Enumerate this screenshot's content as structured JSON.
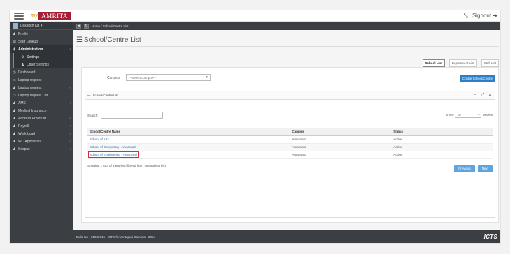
{
  "header": {
    "logo_prefix": "my",
    "logo_brand": "AMRITA",
    "expand_icon": "⤡",
    "signout_label": "Signout ➜"
  },
  "sidebar": {
    "user": "Dakshith KB ▾",
    "items": [
      {
        "icon": "♟",
        "label": "Profile"
      },
      {
        "icon": "▤",
        "label": "Staff Lookup"
      },
      {
        "icon": "♟",
        "label": "Administration",
        "chev": "‹"
      },
      {
        "icon": "⚙",
        "label": "Settings",
        "sub": true
      },
      {
        "icon": "♟",
        "label": "Other Settings",
        "sub": true
      },
      {
        "icon": "◷",
        "label": "Dashboard"
      },
      {
        "icon": "▭",
        "label": "Laptop request"
      },
      {
        "icon": "♟",
        "label": "Laptop request",
        "chev": "‹"
      },
      {
        "icon": "▭",
        "label": "Laptop request List"
      },
      {
        "icon": "♟",
        "label": "AMS",
        "chev": "‹"
      },
      {
        "icon": "♟",
        "label": "Medical Insurance"
      },
      {
        "icon": "♟",
        "label": "Address Proof Ltd.",
        "chev": "‹"
      },
      {
        "icon": "♟",
        "label": "Payroll",
        "chev": "‹"
      },
      {
        "icon": "♟",
        "label": "Work Load",
        "chev": "‹"
      },
      {
        "icon": "♟",
        "label": "WC Appraisals",
        "chev": "‹"
      },
      {
        "icon": "♟",
        "label": "Scopus",
        "chev": "‹"
      }
    ]
  },
  "breadcrumb": {
    "text": "Home  /  School/Centre List"
  },
  "page": {
    "title": "School/Centre List",
    "tabs": [
      "School List",
      "Department List",
      "Staff List"
    ],
    "campus_label": "Campus",
    "campus_select": "---Select Campus---",
    "create_button": "Create School/Centre",
    "panel_title": "School/Centre List",
    "search_label": "Search:",
    "show_label": "Show",
    "show_value": "10",
    "entries_label": "entries",
    "table": {
      "headers": [
        "School/Centre Name",
        "Campus",
        "Status"
      ],
      "rows": [
        [
          "School of Arts",
          "Amaravati",
          "Active"
        ],
        [
          "School of Computing - Amaravati",
          "Amaravati",
          "Active"
        ],
        [
          "School of Engineering - Amaravati",
          "Amaravati",
          "Active"
        ]
      ]
    },
    "info": "Showing 1 to 3 of 3 entries (filtered from 76 total entries)",
    "prev": "Previous",
    "next": "Next"
  },
  "footer": {
    "text": "Build No - 21042715 | ICTS © Amritapuri Campus - 2024",
    "logo": "ICTS"
  }
}
